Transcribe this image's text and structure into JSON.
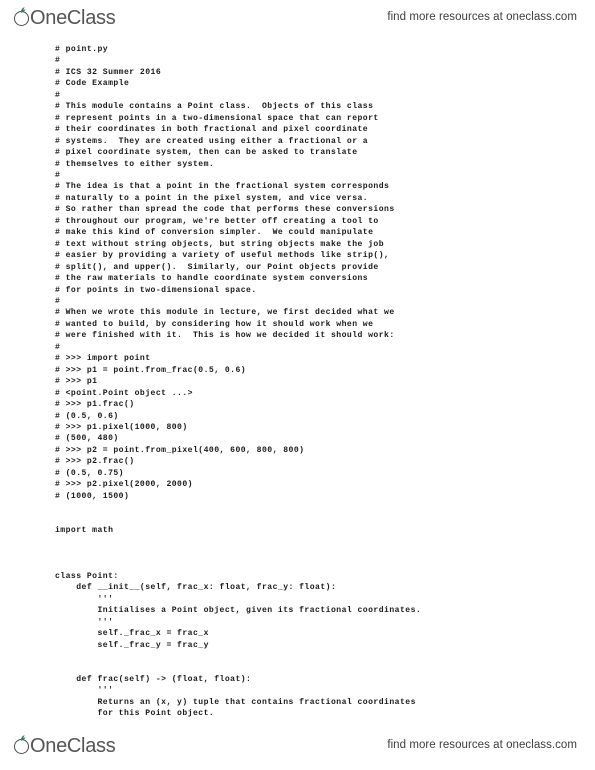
{
  "branding": {
    "logo_text": "OneClass",
    "logo_icon": "oneclass-leaf-o-icon",
    "tagline": "find more resources at oneclass.com",
    "accent_color": "#2e7d4f",
    "text_color": "#555555"
  },
  "document": {
    "file_name": "point.py",
    "language": "python",
    "code_lines": [
      "# point.py",
      "#",
      "# ICS 32 Summer 2016",
      "# Code Example",
      "#",
      "# This module contains a Point class.  Objects of this class",
      "# represent points in a two-dimensional space that can report",
      "# their coordinates in both fractional and pixel coordinate",
      "# systems.  They are created using either a fractional or a",
      "# pixel coordinate system, then can be asked to translate",
      "# themselves to either system.",
      "#",
      "# The idea is that a point in the fractional system corresponds",
      "# naturally to a point in the pixel system, and vice versa.",
      "# So rather than spread the code that performs these conversions",
      "# throughout our program, we're better off creating a tool to",
      "# make this kind of conversion simpler.  We could manipulate",
      "# text without string objects, but string objects make the job",
      "# easier by providing a variety of useful methods like strip(),",
      "# split(), and upper().  Similarly, our Point objects provide",
      "# the raw materials to handle coordinate system conversions",
      "# for points in two-dimensional space.",
      "#",
      "# When we wrote this module in lecture, we first decided what we",
      "# wanted to build, by considering how it should work when we",
      "# were finished with it.  This is how we decided it should work:",
      "#",
      "# >>> import point",
      "# >>> p1 = point.from_frac(0.5, 0.6)",
      "# >>> p1",
      "# <point.Point object ...>",
      "# >>> p1.frac()",
      "# (0.5, 0.6)",
      "# >>> p1.pixel(1000, 800)",
      "# (500, 480)",
      "# >>> p2 = point.from_pixel(400, 600, 800, 800)",
      "# >>> p2.frac()",
      "# (0.5, 0.75)",
      "# >>> p2.pixel(2000, 2000)",
      "# (1000, 1500)",
      "",
      "",
      "import math",
      "",
      "",
      "",
      "class Point:",
      "    def __init__(self, frac_x: float, frac_y: float):",
      "        '''",
      "        Initialises a Point object, given its fractional coordinates.",
      "        '''",
      "        self._frac_x = frac_x",
      "        self._frac_y = frac_y",
      "",
      "",
      "    def frac(self) -> (float, float):",
      "        '''",
      "        Returns an (x, y) tuple that contains fractional coordinates",
      "        for this Point object.",
      "        '''"
    ]
  }
}
